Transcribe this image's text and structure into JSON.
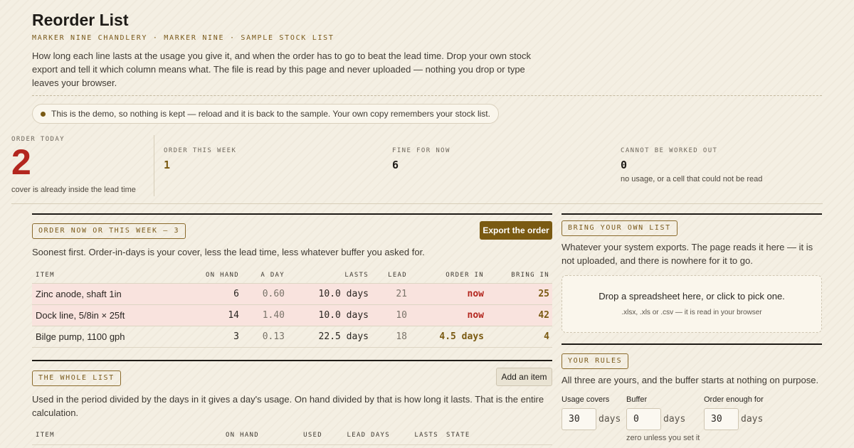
{
  "header": {
    "title": "Reorder List",
    "subtitle": "MARKER NINE CHANDLERY · MARKER NINE · SAMPLE STOCK LIST",
    "intro": "How long each line lasts at the usage you give it, and when the order has to go to beat the lead time. Drop your own stock export and tell it which column means what. The file is read by this page and never uploaded — nothing you drop or type leaves your browser."
  },
  "notice": "This is the demo, so nothing is kept — reload and it is back to the sample. Your own copy remembers your stock list.",
  "stats": {
    "order_today": {
      "label": "ORDER TODAY",
      "value": "2",
      "note": "cover is already inside the lead time"
    },
    "order_week": {
      "label": "ORDER THIS WEEK",
      "value": "1"
    },
    "fine": {
      "label": "FINE FOR NOW",
      "value": "6"
    },
    "cannot": {
      "label": "CANNOT BE WORKED OUT",
      "value": "0",
      "note": "no usage, or a cell that could not be read"
    }
  },
  "order_section": {
    "chip": "ORDER NOW OR THIS WEEK — 3",
    "export_button": "Export the order",
    "description": "Soonest first. Order-in-days is your cover, less the lead time, less whatever buffer you asked for.",
    "columns": [
      "ITEM",
      "ON HAND",
      "A DAY",
      "LASTS",
      "LEAD",
      "ORDER IN",
      "BRING IN"
    ],
    "rows": [
      {
        "item": "Zinc anode, shaft 1in",
        "on_hand": "6",
        "a_day": "0.60",
        "lasts": "10.0 days",
        "lead": "21",
        "order_in": "now",
        "bring_in": "25"
      },
      {
        "item": "Dock line, 5/8in × 25ft",
        "on_hand": "14",
        "a_day": "1.40",
        "lasts": "10.0 days",
        "lead": "10",
        "order_in": "now",
        "bring_in": "42"
      },
      {
        "item": "Bilge pump, 1100 gph",
        "on_hand": "3",
        "a_day": "0.13",
        "lasts": "22.5 days",
        "lead": "18",
        "order_in": "4.5 days",
        "bring_in": "4"
      }
    ]
  },
  "whole_list": {
    "chip": "THE WHOLE LIST",
    "add_button": "Add an item",
    "description": "Used in the period divided by the days in it gives a day's usage. On hand divided by that is how long it lasts. That is the entire calculation.",
    "columns": [
      "ITEM",
      "ON HAND",
      "USED",
      "LEAD DAYS",
      "LASTS",
      "STATE"
    ]
  },
  "bring_list": {
    "chip": "BRING YOUR OWN LIST",
    "description": "Whatever your system exports. The page reads it here — it is not uploaded, and there is nowhere for it to go.",
    "drop_main": "Drop a spreadsheet here, or click to pick one.",
    "drop_sub": ".xlsx, .xls or .csv — it is read in your browser"
  },
  "rules": {
    "chip": "YOUR RULES",
    "description": "All three are yours, and the buffer starts at nothing on purpose.",
    "usage_covers": {
      "label": "Usage covers",
      "value": "30",
      "unit": "days"
    },
    "buffer": {
      "label": "Buffer",
      "value": "0",
      "unit": "days",
      "note": "zero unless you set it"
    },
    "order_enough": {
      "label": "Order enough for",
      "value": "30",
      "unit": "days"
    }
  },
  "colors": {
    "alert": "#b3261e",
    "accent": "#7a5a12",
    "background": "#f4efe3",
    "alert_row": "#f9e3de"
  }
}
